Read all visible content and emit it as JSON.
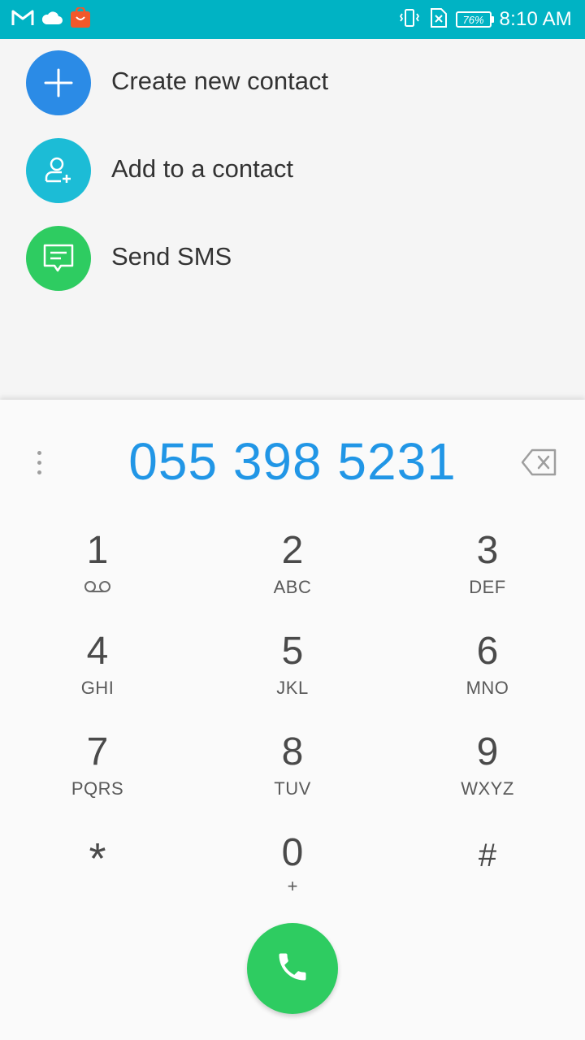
{
  "status_bar": {
    "time": "8:10 AM",
    "battery_percent": "76%",
    "left_icons": [
      "gmail-icon",
      "cloud-icon",
      "shopping-app-icon"
    ],
    "right_icons": [
      "vibrate-icon",
      "no-sim-icon",
      "battery-icon"
    ]
  },
  "actions": {
    "create_contact": {
      "label": "Create new contact",
      "icon": "plus-icon",
      "color": "#2b8be6"
    },
    "add_to_contact": {
      "label": "Add to a contact",
      "icon": "add-person-icon",
      "color": "#1cbcd6"
    },
    "send_sms": {
      "label": "Send SMS",
      "icon": "message-icon",
      "color": "#2ecc61"
    }
  },
  "dialer": {
    "number": "055 398 5231",
    "number_color": "#2196e6",
    "keys": [
      {
        "digit": "1",
        "letters": ""
      },
      {
        "digit": "2",
        "letters": "ABC"
      },
      {
        "digit": "3",
        "letters": "DEF"
      },
      {
        "digit": "4",
        "letters": "GHI"
      },
      {
        "digit": "5",
        "letters": "JKL"
      },
      {
        "digit": "6",
        "letters": "MNO"
      },
      {
        "digit": "7",
        "letters": "PQRS"
      },
      {
        "digit": "8",
        "letters": "TUV"
      },
      {
        "digit": "9",
        "letters": "WXYZ"
      },
      {
        "digit": "*",
        "letters": ""
      },
      {
        "digit": "0",
        "letters": "+"
      },
      {
        "digit": "#",
        "letters": ""
      }
    ],
    "call_button_color": "#2ecc61"
  }
}
